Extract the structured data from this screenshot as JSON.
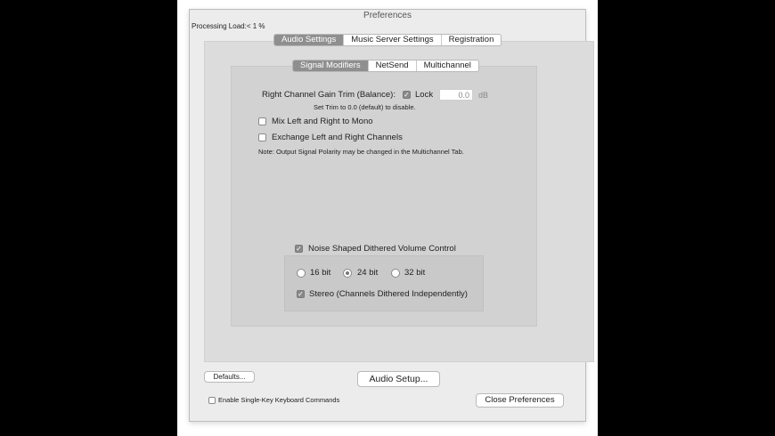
{
  "window": {
    "title": "Preferences"
  },
  "status": {
    "processing_load": "Processing Load:< 1  %"
  },
  "top_tabs": [
    "Audio Settings",
    "Music Server Settings",
    "Registration"
  ],
  "sub_tabs": [
    "Signal Modifiers",
    "NetSend",
    "Multichannel"
  ],
  "gain_trim": {
    "label": "Right Channel Gain Trim (Balance):",
    "lock_label": "Lock",
    "lock_checked": true,
    "value": "0.0",
    "unit": "dB",
    "hint": "Set Trim to 0.0 (default) to disable."
  },
  "options": {
    "mix_mono": "Mix Left and Right to Mono",
    "exchange_channels": "Exchange Left and Right Channels",
    "note": "Note: Output Signal Polarity may be changed in the Multichannel Tab."
  },
  "dither": {
    "label": "Noise Shaped Dithered Volume Control",
    "enabled": true,
    "bits": [
      "16 bit",
      "24 bit",
      "32 bit"
    ],
    "selected": "24 bit",
    "stereo_label": "Stereo (Channels Dithered Independently)",
    "stereo_checked": true
  },
  "buttons": {
    "defaults": "Defaults...",
    "audio_setup": "Audio Setup...",
    "close": "Close Preferences"
  },
  "keyboard": {
    "label": "Enable Single-Key Keyboard Commands"
  }
}
